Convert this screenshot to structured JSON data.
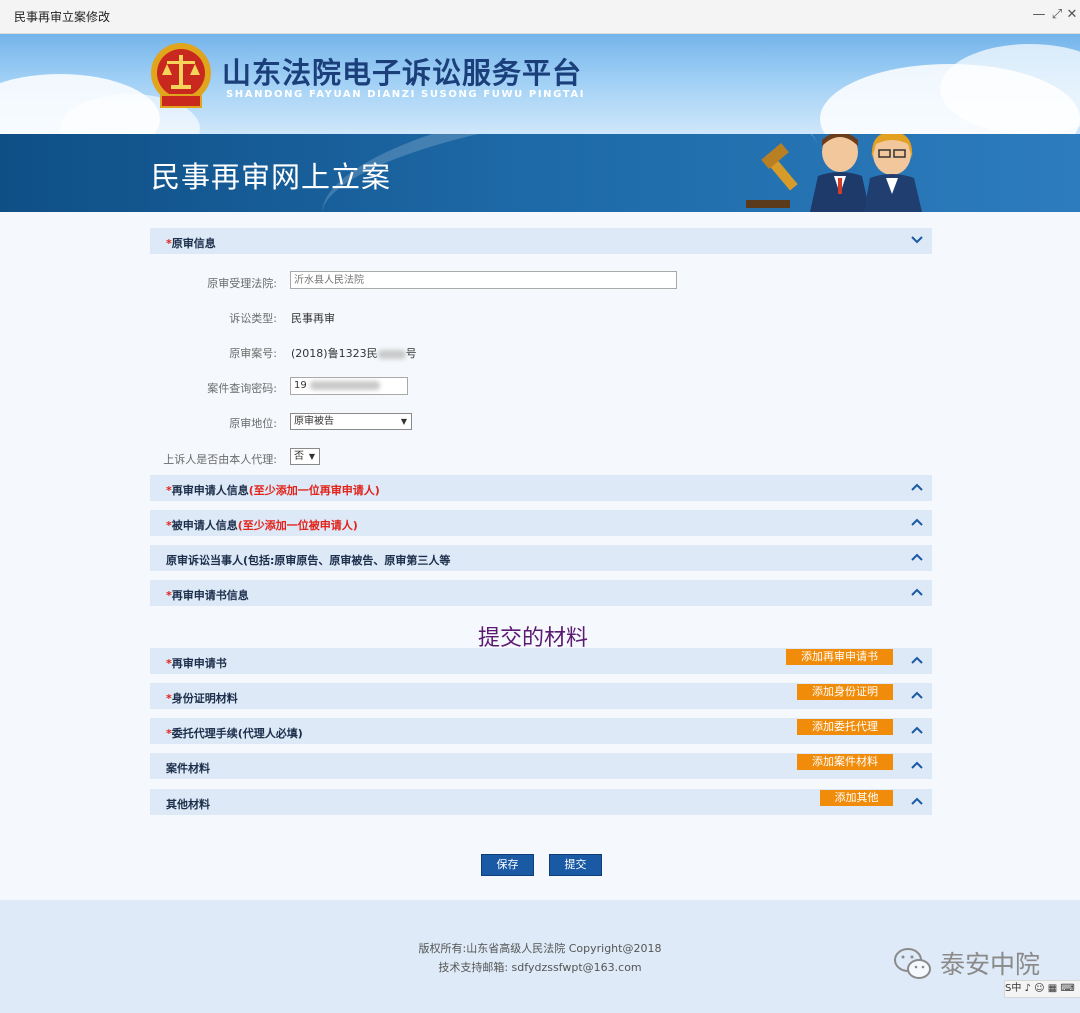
{
  "window": {
    "title": "民事再审立案修改",
    "min_glyph": "—",
    "max_glyph": "⤢",
    "close_glyph": "✕"
  },
  "header": {
    "title_cn": "山东法院电子诉讼服务平台",
    "title_en": "SHANDONG FAYUAN DIANZI SUSONG FUWU PINGTAI",
    "subtitle": "民事再审网上立案"
  },
  "original_trial": {
    "section_label": "原审信息",
    "court_label": "原审受理法院:",
    "court_placeholder": "沂水县人民法院",
    "type_label": "诉讼类型:",
    "type_value": "民事再审",
    "case_no_label": "原审案号:",
    "case_no_prefix": "(2018)鲁1323民",
    "case_no_suffix": "号",
    "password_label": "案件查询密码:",
    "password_value": "19",
    "status_label": "原审地位:",
    "status_value": "原审被告",
    "self_label": "上诉人是否由本人代理:",
    "self_value": "否"
  },
  "sections": [
    {
      "star": "*",
      "label": "再审申请人信息",
      "warning": "(至少添加一位再审申请人)"
    },
    {
      "star": "*",
      "label": "被申请人信息",
      "warning": "(至少添加一位被申请人)"
    },
    {
      "star": "",
      "label": "原审诉讼当事人(包括:原审原告、原审被告、原审第三人等",
      "warning": ""
    },
    {
      "star": "*",
      "label": "再审申请书信息",
      "warning": ""
    }
  ],
  "materials_heading": "提交的材料",
  "materials": [
    {
      "star": "*",
      "label": "再审申请书",
      "button": "添加再审申请书"
    },
    {
      "star": "*",
      "label": "身份证明材料",
      "button": "添加身份证明"
    },
    {
      "star": "*",
      "label": "委托代理手续(代理人必填)",
      "button": "添加委托代理"
    },
    {
      "star": "",
      "label": "案件材料",
      "button": "添加案件材料"
    },
    {
      "star": "",
      "label": "其他材料",
      "button": "添加其他"
    }
  ],
  "actions": {
    "save": "保存",
    "submit": "提交"
  },
  "footer": {
    "copyright": "版权所有:山东省高级人民法院 Copyright@2018",
    "support": "技术支持邮箱: sdfydzssfwpt@163.com",
    "watermark": "泰安中院",
    "ime": "S中 ♪ ☺ ▦ ⌨"
  },
  "colors": {
    "accent": "#1a5aa5",
    "orange": "#f08c0a",
    "section_bg": "#dde9f7",
    "star": "#e2231a"
  }
}
